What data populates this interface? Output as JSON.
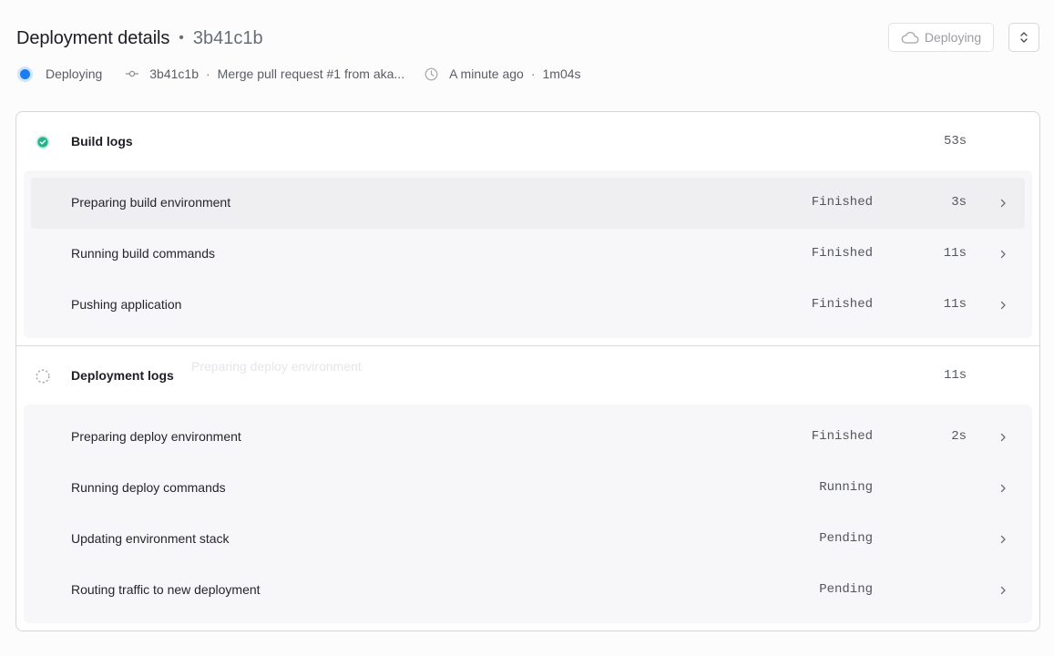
{
  "header": {
    "title": "Deployment details",
    "separator": "•",
    "hash": "3b41c1b",
    "deploy_button_label": "Deploying"
  },
  "meta": {
    "status": "Deploying",
    "commit_hash": "3b41c1b",
    "dot1": "·",
    "commit_message": "Merge pull request #1 from aka...",
    "time_ago": "A minute ago",
    "dot2": "·",
    "duration": "1m04s"
  },
  "build": {
    "title": "Build logs",
    "duration": "53s",
    "steps": [
      {
        "label": "Preparing build environment",
        "state": "Finished",
        "time": "3s"
      },
      {
        "label": "Running build commands",
        "state": "Finished",
        "time": "11s"
      },
      {
        "label": "Pushing application",
        "state": "Finished",
        "time": "11s"
      }
    ]
  },
  "deploy": {
    "title": "Deployment logs",
    "duration": "11s",
    "ghost_text": "Preparing deploy environment",
    "steps": [
      {
        "label": "Preparing deploy environment",
        "state": "Finished",
        "time": "2s"
      },
      {
        "label": "Running deploy commands",
        "state": "Running",
        "time": ""
      },
      {
        "label": "Updating environment stack",
        "state": "Pending",
        "time": ""
      },
      {
        "label": "Routing traffic to new deployment",
        "state": "Pending",
        "time": ""
      }
    ]
  },
  "colors": {
    "status_blue": "#1a7ef0",
    "success_green": "#21b58c"
  },
  "icons": {
    "cloud": "cloud-icon",
    "toggle": "chevron-up-down-icon",
    "commit": "git-commit-icon",
    "clock": "clock-icon",
    "check": "check-circle-icon",
    "spinner": "loading-circle-icon",
    "chevron": "chevron-right-icon"
  }
}
